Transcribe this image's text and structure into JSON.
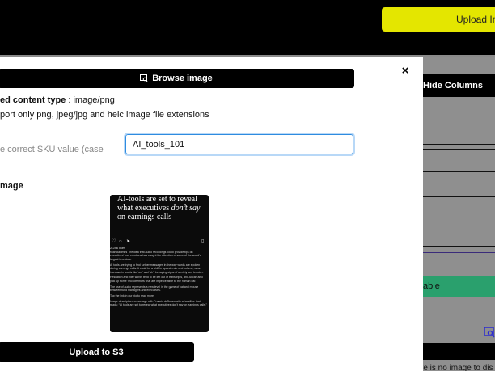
{
  "background": {
    "upload_button_label": "Upload Ima",
    "hide_columns_label": "Hide Columns",
    "table_button_label": "table",
    "no_image_text": "re is no image to dis"
  },
  "modal": {
    "browse_label": "Browse image",
    "close_label": "×",
    "content_type_label": "ed content type",
    "content_type_value": " : image/png",
    "support_text": "port only png, jpeg/jpg and heic image file extensions",
    "sku_label": "e correct SKU value (case",
    "sku_input_value": "AI_tools_101",
    "image_label": "mage",
    "upload_s3_label": "Upload to S3"
  },
  "preview": {
    "headline_start": "AI-tools are set to reveal what executives ",
    "headline_italic": "don’t say",
    "headline_end": " on earnings calls",
    "likes": "2,246 likes",
    "body": [
      "financialtimes The idea that audio recordings could provide tips on executives’ true emotions has caught the attention of some of the world’s largest investors.",
      "AI tools are trying to find further messages in the way words are spoken during earnings calls. It could be a shift in speech rate and volume, or an increase in words like ‘um’ and ‘ah’, betraying signs of anxiety and tension.",
      "Hesitation and filler words tend to be left out of transcripts, and AI can also pick up some ‘microtremors’ that are imperceptible to the human ear.",
      "The use of audio represents a new level in the game of cat and mouse between fund managers and executives.",
      "Tap the link in our bio to read more.",
      "Image description: a montage with Francis deSouza with a headline that reads: “AI tools are set to reveal what executives don’t say on earnings calls.”"
    ]
  },
  "colors": {
    "accent_yellow": "#e4e600",
    "accent_green": "#2aa06d",
    "input_focus": "#2f8ce0"
  }
}
